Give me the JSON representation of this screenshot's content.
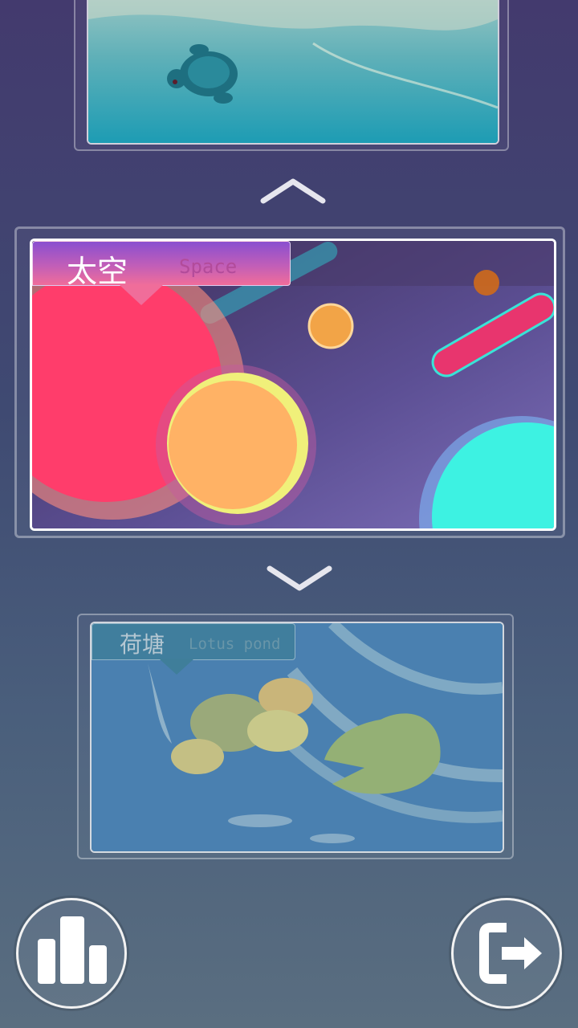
{
  "levels": {
    "previous": {
      "name_cn": "",
      "name_en": "",
      "icon": "turtle-scene"
    },
    "current": {
      "name_cn": "太空",
      "name_en": "Space",
      "icon": "space-scene"
    },
    "next": {
      "name_cn": "荷塘",
      "name_en": "Lotus pond",
      "icon": "lotus-pond-scene"
    }
  },
  "nav": {
    "up_icon": "chevron-up-icon",
    "down_icon": "chevron-down-icon"
  },
  "buttons": {
    "leaderboard_icon": "bar-chart-icon",
    "exit_icon": "exit-icon"
  },
  "colors": {
    "space_tab": "#8a4fd0",
    "space_tab_end": "#f06d9a",
    "pond_tab": "#3f7e9a"
  }
}
